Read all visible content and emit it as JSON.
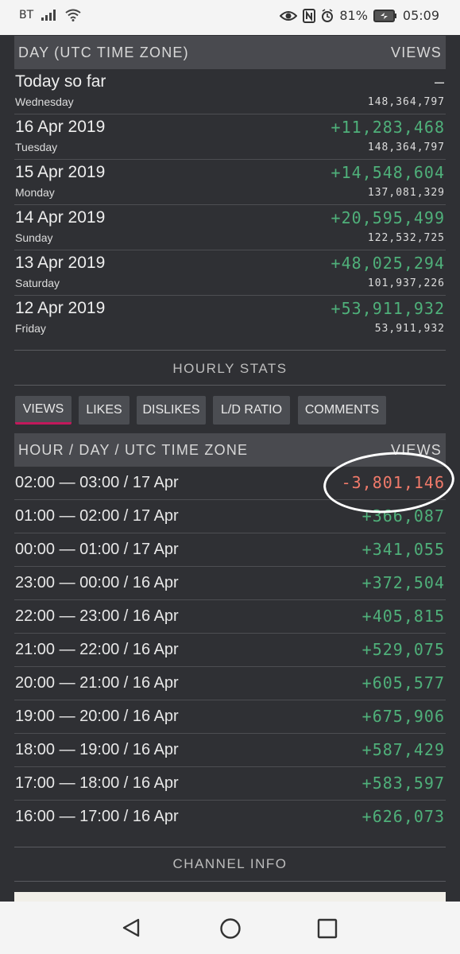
{
  "status_bar": {
    "carrier": "BT",
    "battery": "81%",
    "time": "05:09"
  },
  "daily": {
    "header_day": "DAY (UTC TIME ZONE)",
    "header_views": "VIEWS",
    "rows": [
      {
        "date": "Today so far",
        "weekday": "Wednesday",
        "delta": "–",
        "total": "148,364,797"
      },
      {
        "date": "16 Apr 2019",
        "weekday": "Tuesday",
        "delta": "+11,283,468",
        "total": "148,364,797"
      },
      {
        "date": "15 Apr 2019",
        "weekday": "Monday",
        "delta": "+14,548,604",
        "total": "137,081,329"
      },
      {
        "date": "14 Apr 2019",
        "weekday": "Sunday",
        "delta": "+20,595,499",
        "total": "122,532,725"
      },
      {
        "date": "13 Apr 2019",
        "weekday": "Saturday",
        "delta": "+48,025,294",
        "total": "101,937,226"
      },
      {
        "date": "12 Apr 2019",
        "weekday": "Friday",
        "delta": "+53,911,932",
        "total": "53,911,932"
      }
    ]
  },
  "hourly": {
    "title": "HOURLY STATS",
    "tabs": [
      {
        "label": "VIEWS",
        "active": true
      },
      {
        "label": "LIKES",
        "active": false
      },
      {
        "label": "DISLIKES",
        "active": false
      },
      {
        "label": "L/D RATIO",
        "active": false
      },
      {
        "label": "COMMENTS",
        "active": false
      }
    ],
    "header_hour": "HOUR / DAY / UTC TIME ZONE",
    "header_views": "VIEWS",
    "rows": [
      {
        "hour": "02:00 — 03:00 / 17 Apr",
        "value": "-3,801,146"
      },
      {
        "hour": "01:00 — 02:00 / 17 Apr",
        "value": "+366,087"
      },
      {
        "hour": "00:00 — 01:00 / 17 Apr",
        "value": "+341,055"
      },
      {
        "hour": "23:00 — 00:00 / 16 Apr",
        "value": "+372,504"
      },
      {
        "hour": "22:00 — 23:00 / 16 Apr",
        "value": "+405,815"
      },
      {
        "hour": "21:00 — 22:00 / 16 Apr",
        "value": "+529,075"
      },
      {
        "hour": "20:00 — 21:00 / 16 Apr",
        "value": "+605,577"
      },
      {
        "hour": "19:00 — 20:00 / 16 Apr",
        "value": "+675,906"
      },
      {
        "hour": "18:00 — 19:00 / 16 Apr",
        "value": "+587,429"
      },
      {
        "hour": "17:00 — 18:00 / 16 Apr",
        "value": "+583,597"
      },
      {
        "hour": "16:00 — 17:00 / 16 Apr",
        "value": "+626,073"
      }
    ]
  },
  "channel_info": {
    "title": "CHANNEL INFO"
  },
  "colors": {
    "background": "#2f3034",
    "positive": "#4fb07a",
    "negative": "#f07a6a",
    "active_tab_underline": "#c2185b"
  }
}
